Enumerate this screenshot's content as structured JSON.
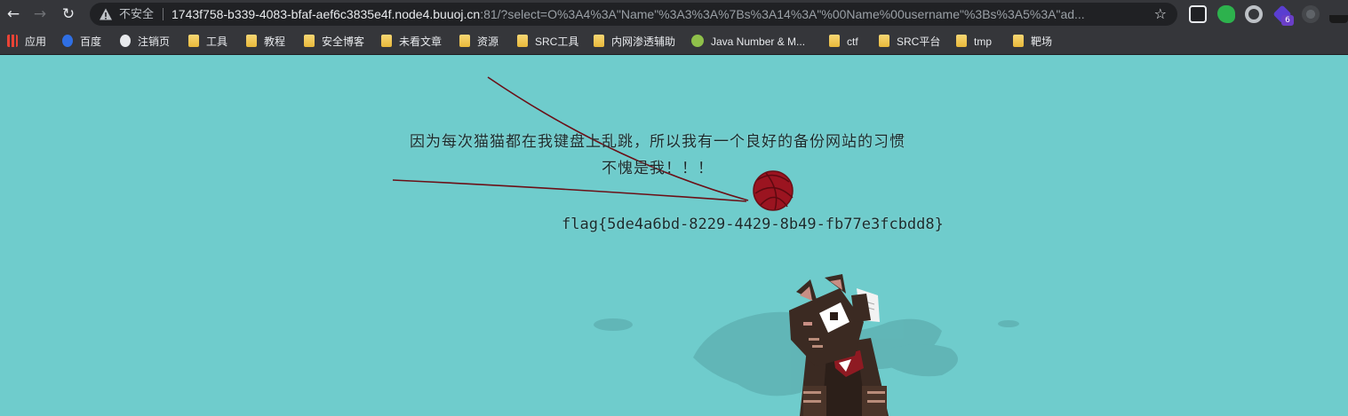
{
  "browser": {
    "nav": {
      "back": "←",
      "forward": "→",
      "reload": "↻"
    },
    "security_label": "不安全",
    "url_host": "1743f758-b339-4083-bfaf-aef6c3835e4f.node4.buuoj.cn",
    "url_rest": ":81/?select=O%3A4%3A\"Name\"%3A3%3A%7Bs%3A14%3A\"%00Name%00username\"%3Bs%3A5%3A\"ad...",
    "bookmark_star": "☆",
    "extension_badge": "6"
  },
  "bookmarks": [
    {
      "label": "应用",
      "icon": "apps-grid-icon"
    },
    {
      "label": "百度",
      "icon": "baidu-icon"
    },
    {
      "label": "注销页",
      "icon": "globe-icon"
    },
    {
      "label": "工具",
      "icon": "folder-icon"
    },
    {
      "label": "教程",
      "icon": "folder-icon"
    },
    {
      "label": "安全博客",
      "icon": "folder-icon"
    },
    {
      "label": "未看文章",
      "icon": "folder-icon"
    },
    {
      "label": "资源",
      "icon": "folder-icon"
    },
    {
      "label": "SRC工具",
      "icon": "folder-icon"
    },
    {
      "label": "内网渗透辅助",
      "icon": "folder-icon"
    },
    {
      "label": "Java Number & M...",
      "icon": "java-icon"
    },
    {
      "label": "ctf",
      "icon": "folder-icon"
    },
    {
      "label": "SRC平台",
      "icon": "folder-icon"
    },
    {
      "label": "tmp",
      "icon": "folder-icon"
    },
    {
      "label": "靶场",
      "icon": "folder-icon"
    }
  ],
  "page": {
    "message_line1": "因为每次猫猫都在我键盘上乱跳，所以我有一个良好的备份网站的习惯",
    "message_line2": "不愧是我！！！",
    "flag": "flag{5de4a6bd-8229-4429-8b49-fb77e3fcbdd8}"
  },
  "colors": {
    "background": "#6fcccc",
    "chrome": "#35363a",
    "yarn": "#9b1420",
    "cat": "#3b2a22"
  }
}
